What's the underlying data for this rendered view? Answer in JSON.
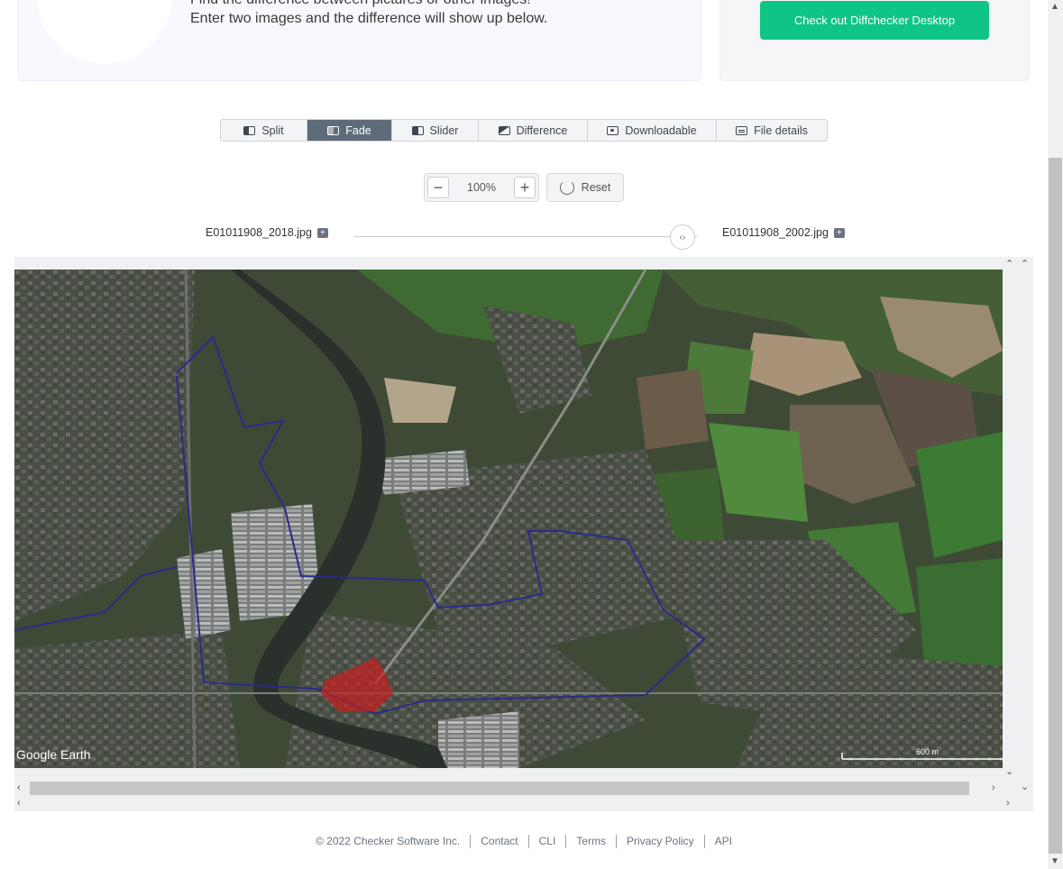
{
  "hero": {
    "line1": "Find the difference between pictures or other images!",
    "line2": "Enter two images and the difference will show up below."
  },
  "cta": {
    "label": "Check out Diffchecker Desktop"
  },
  "tabs": [
    {
      "label": "Split",
      "icon": "split-icon"
    },
    {
      "label": "Fade",
      "icon": "fade-icon",
      "active": true
    },
    {
      "label": "Slider",
      "icon": "slider-icon"
    },
    {
      "label": "Difference",
      "icon": "difference-icon"
    },
    {
      "label": "Downloadable",
      "icon": "download-icon"
    },
    {
      "label": "File details",
      "icon": "file-details-icon"
    }
  ],
  "zoom": {
    "value": "100%",
    "minus": "−",
    "plus": "+",
    "reset_label": "Reset"
  },
  "files": {
    "left": "E01011908_2018.jpg",
    "right": "E01011908_2002.jpg"
  },
  "slider": {
    "handle": "‹›"
  },
  "map": {
    "watermark": "Google Earth",
    "scale": "600 m"
  },
  "footer": {
    "copyright": "© 2022 Checker Software Inc.",
    "links": [
      "Contact",
      "CLI",
      "Terms",
      "Privacy Policy",
      "API"
    ]
  },
  "colors": {
    "accent": "#0ec585",
    "active_tab": "#5d6b7a",
    "boundary": "#2a2a8a",
    "highlight": "#c81e1e"
  }
}
